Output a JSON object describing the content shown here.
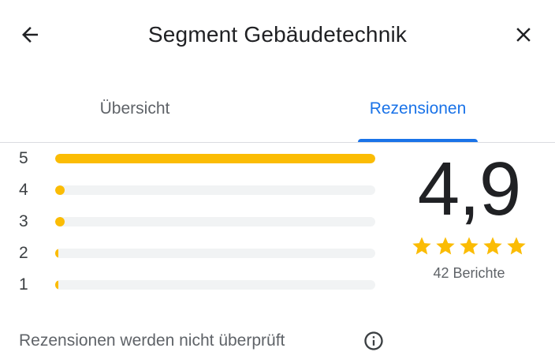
{
  "header": {
    "title": "Segment Gebäudetechnik",
    "back_icon": "arrow-back-icon",
    "close_icon": "close-icon"
  },
  "tabs": [
    {
      "label": "Übersicht",
      "active": false
    },
    {
      "label": "Rezensionen",
      "active": true
    }
  ],
  "histogram": {
    "rows": [
      {
        "label": "5",
        "fraction": 1.0
      },
      {
        "label": "4",
        "fraction": 0.025
      },
      {
        "label": "3",
        "fraction": 0.025
      },
      {
        "label": "2",
        "fraction": 0.0
      },
      {
        "label": "1",
        "fraction": 0.0
      }
    ]
  },
  "summary": {
    "score": "4,9",
    "stars_filled": 5,
    "stars_total": 5,
    "count_text": "42 Berichte"
  },
  "footer": {
    "note": "Rezensionen werden nicht überprüft",
    "info_icon": "info-icon"
  },
  "colors": {
    "accent": "#1a73e8",
    "star": "#fbbc04",
    "track": "#f1f3f4",
    "text_primary": "#202124",
    "text_secondary": "#5f6368"
  }
}
